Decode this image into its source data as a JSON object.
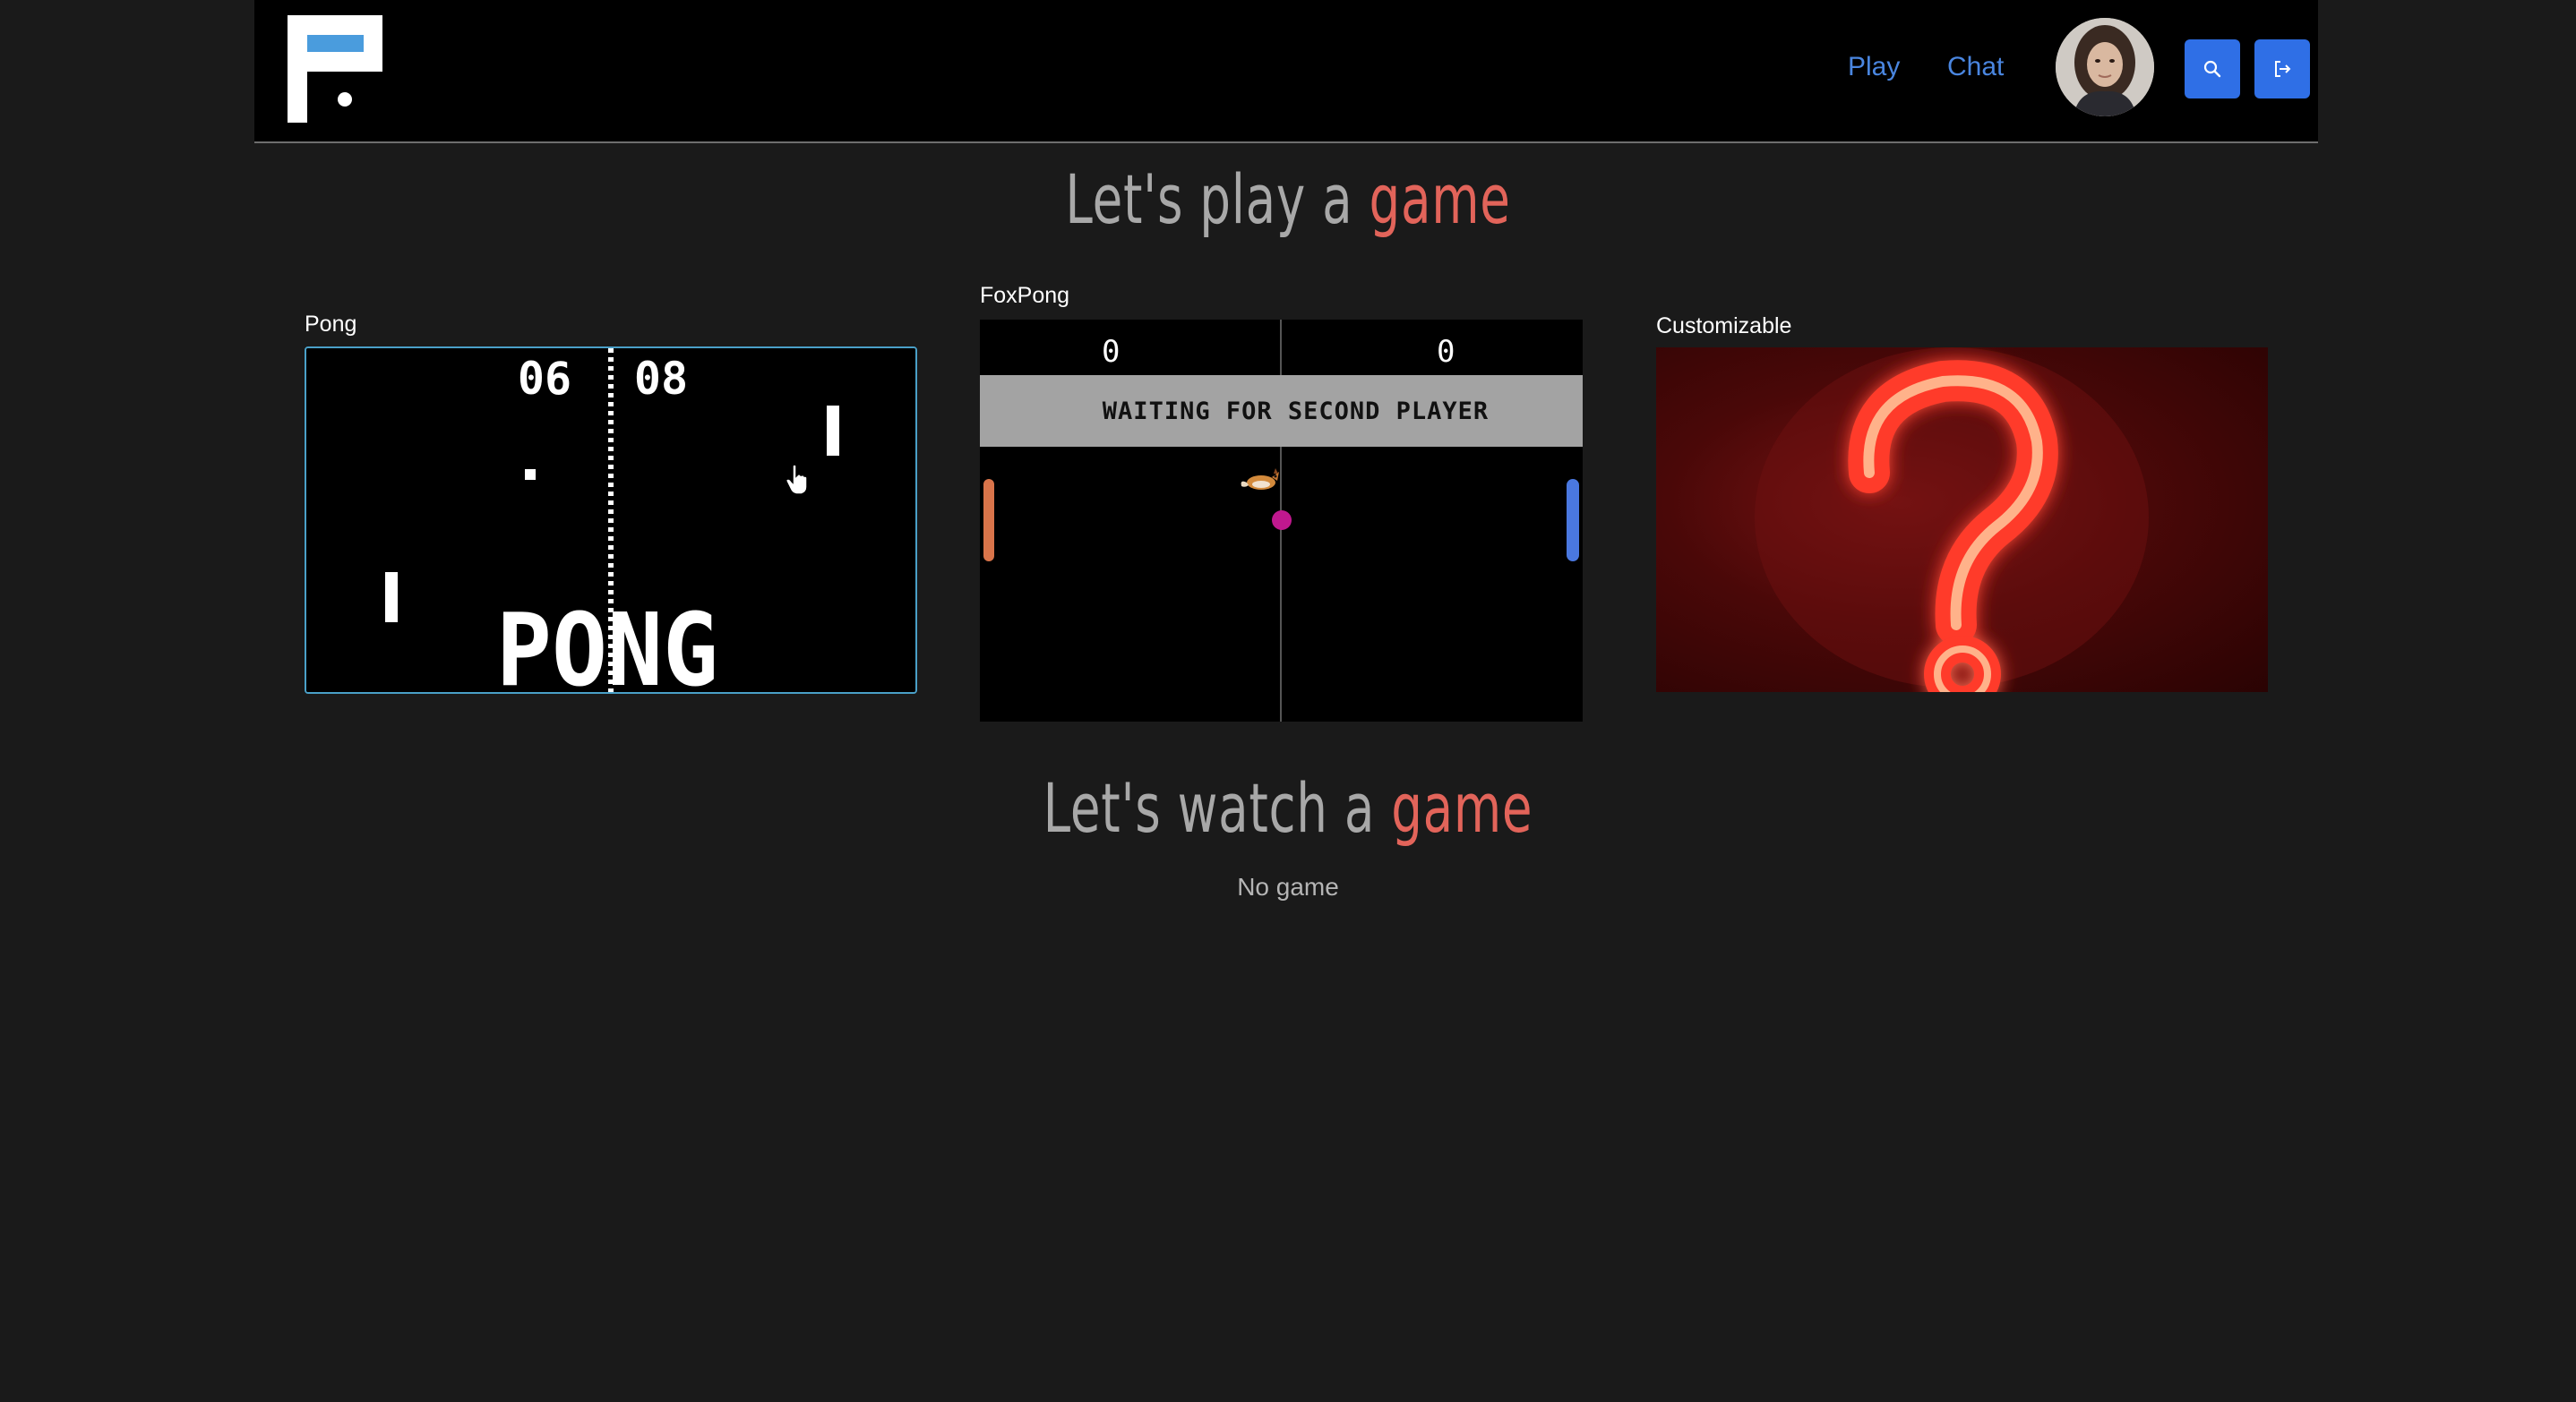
{
  "nav": {
    "play_label": "Play",
    "chat_label": "Chat"
  },
  "headings": {
    "play_prefix": "Let's play a ",
    "play_accent": "game",
    "watch_prefix": "Let's watch a ",
    "watch_accent": "game"
  },
  "games": {
    "pong": {
      "title": "Pong",
      "score_left": "06",
      "score_right": "08",
      "logo_text": "PONG"
    },
    "foxpong": {
      "title": "FoxPong",
      "score_left": "0",
      "score_right": "0",
      "banner": "WAITING FOR SECOND PLAYER"
    },
    "customizable": {
      "title": "Customizable"
    }
  },
  "watch": {
    "empty_text": "No game"
  },
  "colors": {
    "accent": "#e2645a",
    "nav_link": "#4a86e0",
    "button": "#2f6fe6",
    "background": "#1a1a1a",
    "header": "#000000"
  },
  "icons": [
    "logo-icon",
    "avatar",
    "search-icon",
    "logout-icon",
    "question-mark-icon",
    "fox-sprite-icon",
    "hand-cursor-icon"
  ]
}
